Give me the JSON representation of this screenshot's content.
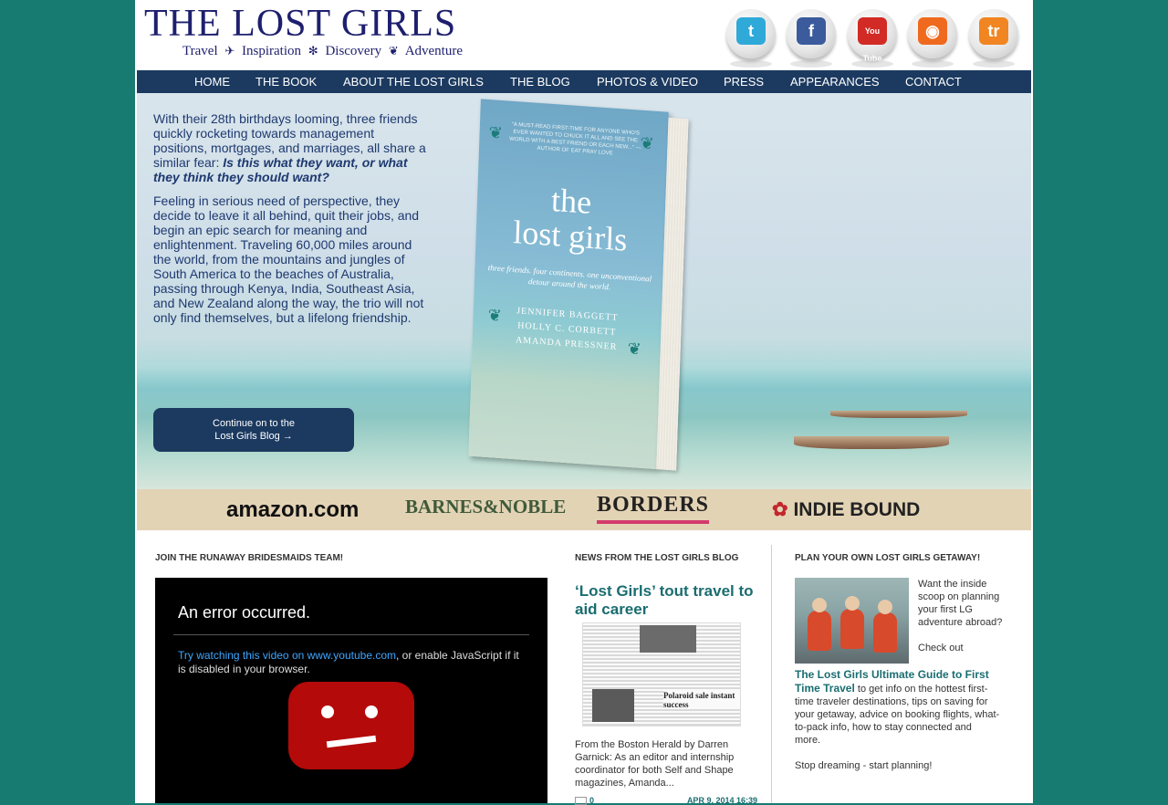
{
  "header": {
    "logo_title": "THE LOST GIRLS",
    "logo_tagline": [
      "Travel",
      "Inspiration",
      "Discovery",
      "Adventure"
    ]
  },
  "social": [
    {
      "name": "twitter-icon",
      "glyph": "t",
      "color": "#2fa9d8"
    },
    {
      "name": "facebook-icon",
      "glyph": "f",
      "color": "#3b5b9c"
    },
    {
      "name": "youtube-icon",
      "glyph": "You Tube",
      "color": "#d22a25"
    },
    {
      "name": "rss-icon",
      "glyph": "◉",
      "color": "#ef6a1e"
    },
    {
      "name": "tripadvisor-icon",
      "glyph": "tr",
      "color": "#f08522"
    }
  ],
  "nav": [
    "HOME",
    "THE BOOK",
    "ABOUT THE LOST GIRLS",
    "THE BLOG",
    "PHOTOS & VIDEO",
    "PRESS",
    "APPEARANCES",
    "CONTACT"
  ],
  "hero": {
    "p1_start": "With their 28th birthdays looming, three friends quickly rocketing towards management positions, mortgages, and marriages, all share a similar fear: ",
    "p1_em": "Is this what they want, or what they think they should want?",
    "p2": "Feeling in serious need of perspective, they decide to leave it all behind, quit their jobs, and begin an epic search for meaning and enlightenment. Traveling 60,000 miles around the world, from the mountains and jungles of South America to the beaches of Australia, passing through Kenya, India, Southeast Asia, and New Zealand along the way, the trio will not only find themselves, but a lifelong friendship.",
    "button_line1": "Continue on to the",
    "button_line2": "Lost Girls Blog →"
  },
  "book": {
    "quote": "“A MUST-READ FIRST-TIME FOR ANYONE WHO'S EVER WANTED TO CHUCK IT ALL AND SEE THE WORLD WITH A BEST FRIEND OR EACH NEW...” —AUTHOR OF EAT PRAY LOVE",
    "title_line1": "the",
    "title_line2": "lost girls",
    "subtitle": "three friends. four continents. one unconventional detour around the world.",
    "authors": [
      "JENNIFER BAGGETT",
      "HOLLY C. CORBETT",
      "AMANDA PRESSNER"
    ]
  },
  "retailers": [
    {
      "label": "amazon.com",
      "color": "#111111"
    },
    {
      "label": "BARNES&NOBLE",
      "color": "#3f5a3a"
    },
    {
      "label": "BORDERS",
      "color": "#222222"
    },
    {
      "label": "INDIE BOUND",
      "color": "#222222"
    }
  ],
  "sections": {
    "team": "JOIN THE RUNAWAY BRIDESMAIDS TEAM!",
    "news": "NEWS FROM THE LOST GIRLS BLOG",
    "plan": "PLAN YOUR OWN LOST GIRLS GETAWAY!"
  },
  "video": {
    "error_title": "An error occurred.",
    "link_text": "Try watching this video on www.youtube.com",
    "rest_text": ", or enable JavaScript if it is disabled in your browser."
  },
  "news": {
    "title": "‘Lost Girls’ tout travel to aid career",
    "image_caption": "Polaroid sale instant success",
    "excerpt": "From the Boston Herald by Darren Garnick: As an editor and internship coordinator for both Self and Shape magazines, Amanda...",
    "comments": "0",
    "date": "APR 9, 2014 16:39"
  },
  "getaway": {
    "side_text": "Want the inside scoop on planning your first LG adventure abroad?",
    "checkout_prefix": "Check out ",
    "link": "The Lost Girls Ultimate Guide to First Time Travel",
    "rest": " to get info on the hottest first-time traveler destinations, tips on saving for your getaway, advice on booking flights, what-to-pack info, how to stay connected and more.",
    "closing": "Stop dreaming - start planning!"
  }
}
